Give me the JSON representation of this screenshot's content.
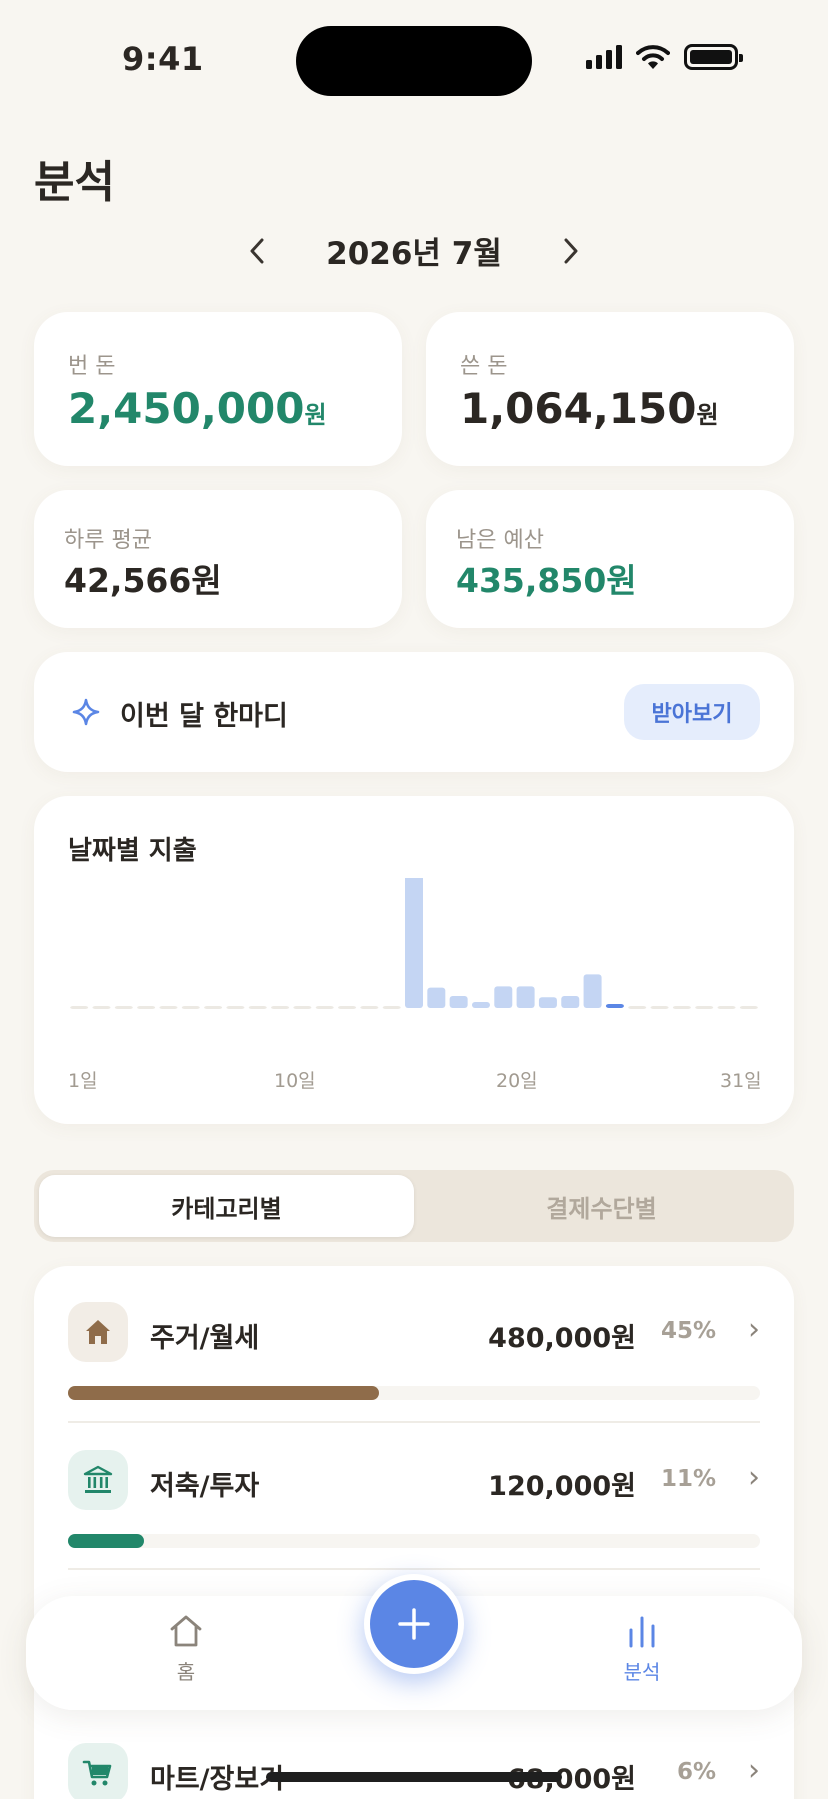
{
  "status_bar": {
    "time": "9:41"
  },
  "page_title": "분석",
  "month_nav": {
    "label": "2026년 7월",
    "prev_icon": "chevron-left",
    "next_icon": "chevron-right"
  },
  "stats": {
    "income": {
      "label": "번 돈",
      "value": "2,450,000",
      "unit": "원"
    },
    "expense": {
      "label": "쓴 돈",
      "value": "1,064,150",
      "unit": "원"
    },
    "daily_avg": {
      "label": "하루 평균",
      "value": "42,566원"
    },
    "remaining": {
      "label": "남은 예산",
      "value": "435,850원"
    }
  },
  "monthly_comment": {
    "icon": "sparkle-icon",
    "label": "이번 달 한마디",
    "button": "받아보기"
  },
  "chart": {
    "title": "날짜별 지출",
    "x_ticks": [
      "1일",
      "10일",
      "20일",
      "31일"
    ]
  },
  "chart_data": {
    "type": "bar",
    "title": "날짜별 지출",
    "categories": [
      "1",
      "2",
      "3",
      "4",
      "5",
      "6",
      "7",
      "8",
      "9",
      "10",
      "11",
      "12",
      "13",
      "14",
      "15",
      "16",
      "17",
      "18",
      "19",
      "20",
      "21",
      "22",
      "23",
      "24",
      "25",
      "26",
      "27",
      "28",
      "29",
      "30",
      "31"
    ],
    "values": [
      0,
      0,
      0,
      0,
      0,
      0,
      0,
      0,
      0,
      0,
      0,
      0,
      0,
      0,
      0,
      480000,
      68000,
      40000,
      20000,
      72000,
      72000,
      36000,
      40000,
      112000,
      12000,
      0,
      0,
      0,
      0,
      0,
      0
    ],
    "highlight_day": "25",
    "ylim": [
      0,
      500000
    ],
    "colors": {
      "bar": "#c4d5f3",
      "today": "#5b86e5",
      "empty": "#ece9e3"
    }
  },
  "segmented": {
    "tabs": [
      "카테고리별",
      "결제수단별"
    ],
    "active": 0
  },
  "categories": [
    {
      "name": "주거/월세",
      "amount": "480,000원",
      "pct": "45%",
      "fraction": 0.45,
      "icon": "house-icon",
      "color": "#8f6c4a",
      "bg": "#f2ede6"
    },
    {
      "name": "저축/투자",
      "amount": "120,000원",
      "pct": "11%",
      "fraction": 0.11,
      "icon": "bank-icon",
      "color": "#22876a",
      "bg": "#e6f2ee"
    },
    {
      "name": "마트/장보기",
      "amount": "68,000원",
      "pct": "6%",
      "fraction": 0.06,
      "icon": "cart-icon",
      "color": "#22876a",
      "bg": "#e6f2ee"
    }
  ],
  "tabbar": {
    "home": "홈",
    "analysis": "분석",
    "add_icon": "plus-icon"
  }
}
